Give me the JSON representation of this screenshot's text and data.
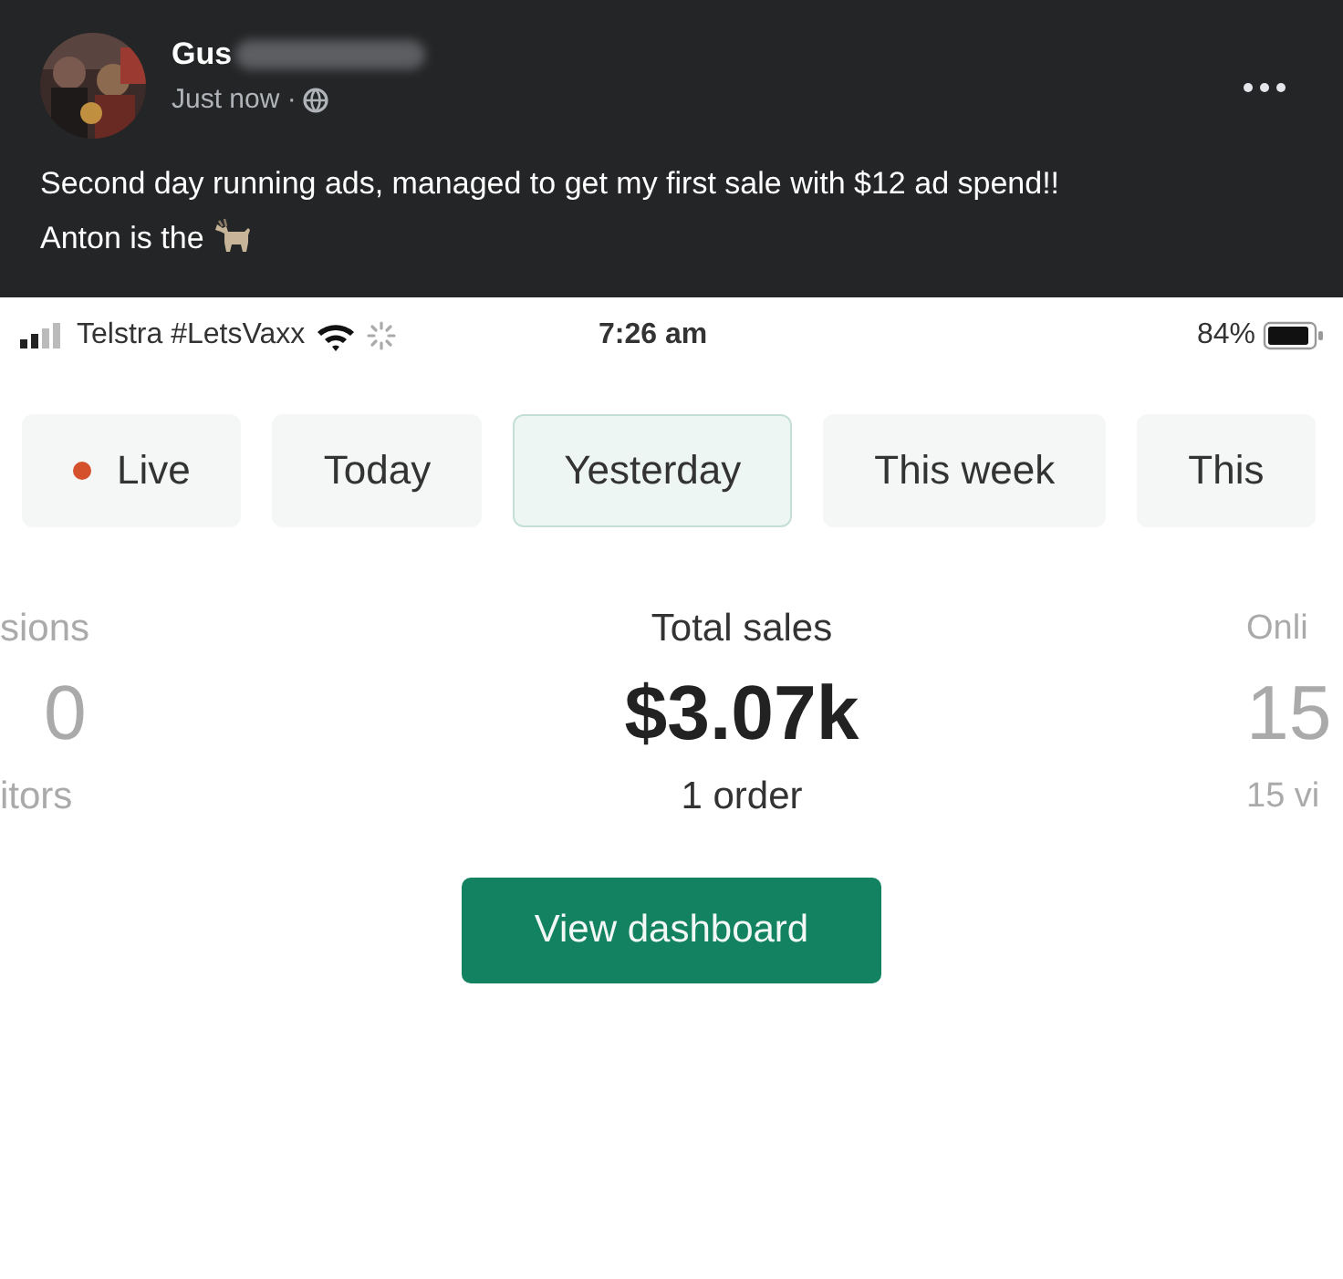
{
  "post": {
    "author": "Gus",
    "author_redacted": true,
    "time": "Just now ·",
    "text": "Second day running ads, managed to get my first sale with $12 ad spend!! Anton is the"
  },
  "status_bar": {
    "carrier": "Telstra #LetsVaxx",
    "time": "7:26 am",
    "battery": "84%"
  },
  "tabs": [
    {
      "label": "Live",
      "kind": "live",
      "selected": false
    },
    {
      "label": "Today",
      "kind": "plain",
      "selected": false
    },
    {
      "label": "Yesterday",
      "kind": "plain",
      "selected": true
    },
    {
      "label": "This week",
      "kind": "plain",
      "selected": false
    },
    {
      "label": "This",
      "kind": "plain",
      "selected": false
    }
  ],
  "metrics": [
    {
      "kind": "side",
      "title": "sions",
      "value": "0",
      "subtitle": "itors"
    },
    {
      "kind": "main",
      "title": "Total sales",
      "value": "$3.07k",
      "subtitle": "1 order"
    },
    {
      "kind": "side",
      "title": "Onli",
      "value": "15",
      "subtitle": "15 vi"
    }
  ],
  "button": "View dashboard"
}
